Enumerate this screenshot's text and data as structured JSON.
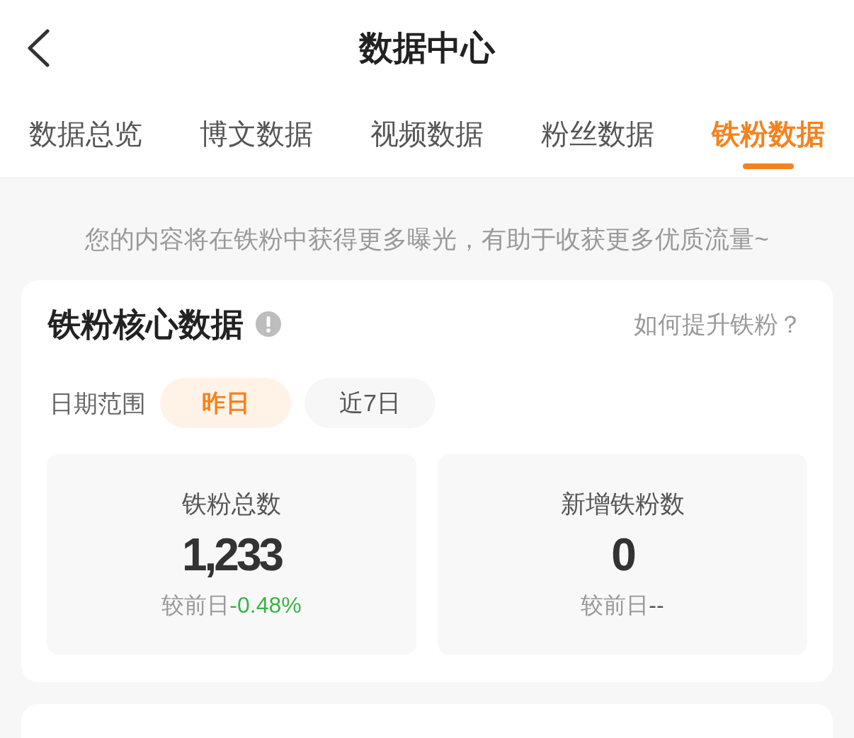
{
  "header": {
    "title": "数据中心"
  },
  "tabs": [
    {
      "label": "数据总览",
      "selected": false
    },
    {
      "label": "博文数据",
      "selected": false
    },
    {
      "label": "视频数据",
      "selected": false
    },
    {
      "label": "粉丝数据",
      "selected": false
    },
    {
      "label": "铁粉数据",
      "selected": true
    }
  ],
  "hint": "您的内容将在铁粉中获得更多曝光，有助于收获更多优质流量~",
  "core_card": {
    "title": "铁粉核心数据",
    "link": "如何提升铁粉？",
    "date_range": {
      "label": "日期范围",
      "options": [
        {
          "label": "昨日",
          "selected": true
        },
        {
          "label": "近7日",
          "selected": false
        }
      ]
    },
    "stats": [
      {
        "label": "铁粉总数",
        "value": "1,233",
        "compare_label": "较前日",
        "change": "-0.48%",
        "color": "#3bb346"
      },
      {
        "label": "新增铁粉数",
        "value": "0",
        "compare_label": "较前日",
        "change": "--",
        "color": "#555555"
      }
    ]
  }
}
